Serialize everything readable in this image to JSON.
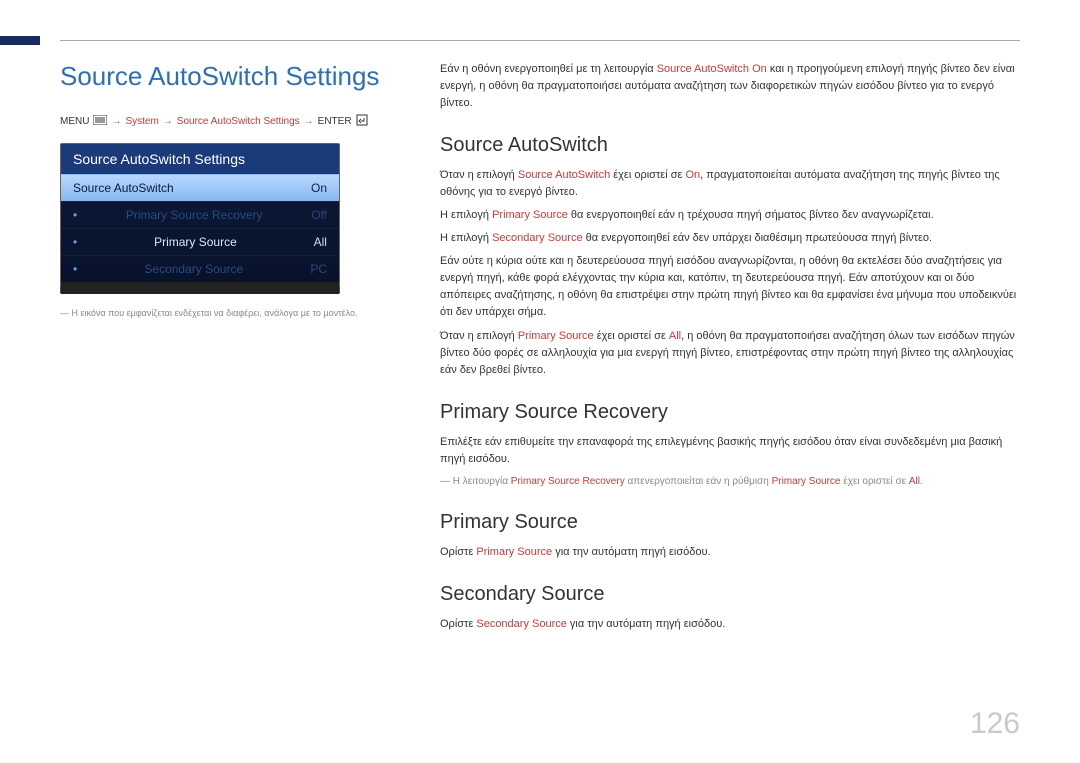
{
  "title": "Source AutoSwitch Settings",
  "breadcrumb": {
    "menu": "MENU",
    "system": "System",
    "item": "Source AutoSwitch Settings",
    "enter": "ENTER"
  },
  "tv": {
    "header": "Source AutoSwitch Settings",
    "rows": [
      {
        "label": "Source AutoSwitch",
        "value": "On",
        "style": "highlight"
      },
      {
        "label": "Primary Source Recovery",
        "value": "Off",
        "style": "dim"
      },
      {
        "label": "Primary Source",
        "value": "All",
        "style": "dot"
      },
      {
        "label": "Secondary Source",
        "value": "PC",
        "style": "dim"
      }
    ]
  },
  "footnote_left": "Η εικόνα που εμφανίζεται ενδέχεται να διαφέρει, ανάλογα με το μοντέλο.",
  "content": {
    "intro_before": "Εάν η οθόνη ενεργοποιηθεί με τη λειτουργία ",
    "intro_red": "Source AutoSwitch On",
    "intro_after": " και η προηγούμενη επιλογή πηγής βίντεο δεν είναι ενεργή, η οθόνη θα πραγματοποιήσει αυτόματα αναζήτηση των διαφορετικών πηγών εισόδου βίντεο για το ενεργό βίντεο.",
    "h_autoswitch": "Source AutoSwitch",
    "p1_a": "Όταν η επιλογή ",
    "p1_r1": "Source AutoSwitch",
    "p1_b": " έχει οριστεί σε ",
    "p1_r2": "On",
    "p1_c": ", πραγματοποιείται αυτόματα αναζήτηση της πηγής βίντεο της οθόνης για το ενεργό βίντεο.",
    "p2_a": "Η επιλογή ",
    "p2_r": "Primary Source",
    "p2_b": " θα ενεργοποιηθεί εάν η τρέχουσα πηγή σήματος βίντεο δεν αναγνωρίζεται.",
    "p3_a": "Η επιλογή ",
    "p3_r": "Secondary Source",
    "p3_b": " θα ενεργοποιηθεί εάν δεν υπάρχει διαθέσιμη πρωτεύουσα πηγή βίντεο.",
    "p4": "Εάν ούτε η κύρια ούτε και η δευτερεύουσα πηγή εισόδου αναγνωρίζονται, η οθόνη θα εκτελέσει δύο αναζητήσεις για ενεργή πηγή, κάθε φορά ελέγχοντας την κύρια και, κατόπιν, τη δευτερεύουσα πηγή. Εάν αποτύχουν και οι δύο απόπειρες αναζήτησης, η οθόνη θα επιστρέψει στην πρώτη πηγή βίντεο και θα εμφανίσει ένα μήνυμα που υποδεικνύει ότι δεν υπάρχει σήμα.",
    "p5_a": "Όταν η επιλογή ",
    "p5_r1": "Primary Source",
    "p5_b": " έχει οριστεί σε ",
    "p5_r2": "All",
    "p5_c": ", η οθόνη θα πραγματοποιήσει αναζήτηση όλων των εισόδων πηγών βίντεο δύο φορές σε αλληλουχία για μια ενεργή πηγή βίντεο, επιστρέφοντας στην πρώτη πηγή βίντεο της αλληλουχίας εάν δεν βρεθεί βίντεο.",
    "h_recovery": "Primary Source Recovery",
    "p_recovery": "Επιλέξτε εάν επιθυμείτε την επαναφορά της επιλεγμένης βασικής πηγής εισόδου όταν είναι συνδεδεμένη μια βασική πηγή εισόδου.",
    "note_recovery_a": "Η λειτουργία ",
    "note_recovery_r1": "Primary Source Recovery",
    "note_recovery_b": " απενεργοποιείται εάν η ρύθμιση ",
    "note_recovery_r2": "Primary Source",
    "note_recovery_c": " έχει οριστεί σε ",
    "note_recovery_r3": "All",
    "note_recovery_d": ".",
    "h_primary": "Primary Source",
    "p_primary_a": "Ορίστε ",
    "p_primary_r": "Primary Source",
    "p_primary_b": " για την αυτόματη πηγή εισόδου.",
    "h_secondary": "Secondary Source",
    "p_secondary_a": "Ορίστε ",
    "p_secondary_r": "Secondary Source",
    "p_secondary_b": " για την αυτόματη πηγή εισόδου."
  },
  "page_number": "126"
}
